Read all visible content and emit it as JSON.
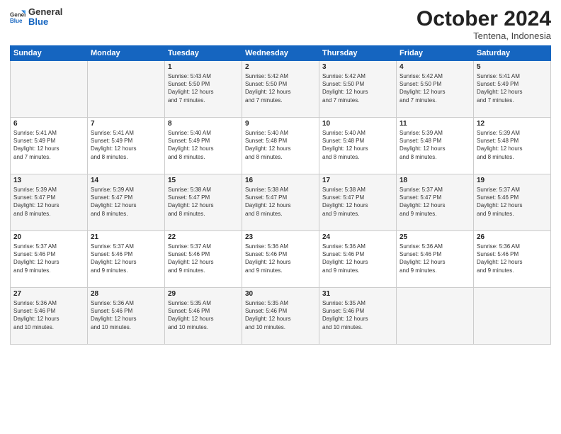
{
  "header": {
    "logo_line1": "General",
    "logo_line2": "Blue",
    "month": "October 2024",
    "location": "Tentena, Indonesia"
  },
  "days_of_week": [
    "Sunday",
    "Monday",
    "Tuesday",
    "Wednesday",
    "Thursday",
    "Friday",
    "Saturday"
  ],
  "weeks": [
    [
      {
        "day": "",
        "info": ""
      },
      {
        "day": "",
        "info": ""
      },
      {
        "day": "1",
        "info": "Sunrise: 5:43 AM\nSunset: 5:50 PM\nDaylight: 12 hours\nand 7 minutes."
      },
      {
        "day": "2",
        "info": "Sunrise: 5:42 AM\nSunset: 5:50 PM\nDaylight: 12 hours\nand 7 minutes."
      },
      {
        "day": "3",
        "info": "Sunrise: 5:42 AM\nSunset: 5:50 PM\nDaylight: 12 hours\nand 7 minutes."
      },
      {
        "day": "4",
        "info": "Sunrise: 5:42 AM\nSunset: 5:50 PM\nDaylight: 12 hours\nand 7 minutes."
      },
      {
        "day": "5",
        "info": "Sunrise: 5:41 AM\nSunset: 5:49 PM\nDaylight: 12 hours\nand 7 minutes."
      }
    ],
    [
      {
        "day": "6",
        "info": "Sunrise: 5:41 AM\nSunset: 5:49 PM\nDaylight: 12 hours\nand 7 minutes."
      },
      {
        "day": "7",
        "info": "Sunrise: 5:41 AM\nSunset: 5:49 PM\nDaylight: 12 hours\nand 8 minutes."
      },
      {
        "day": "8",
        "info": "Sunrise: 5:40 AM\nSunset: 5:49 PM\nDaylight: 12 hours\nand 8 minutes."
      },
      {
        "day": "9",
        "info": "Sunrise: 5:40 AM\nSunset: 5:48 PM\nDaylight: 12 hours\nand 8 minutes."
      },
      {
        "day": "10",
        "info": "Sunrise: 5:40 AM\nSunset: 5:48 PM\nDaylight: 12 hours\nand 8 minutes."
      },
      {
        "day": "11",
        "info": "Sunrise: 5:39 AM\nSunset: 5:48 PM\nDaylight: 12 hours\nand 8 minutes."
      },
      {
        "day": "12",
        "info": "Sunrise: 5:39 AM\nSunset: 5:48 PM\nDaylight: 12 hours\nand 8 minutes."
      }
    ],
    [
      {
        "day": "13",
        "info": "Sunrise: 5:39 AM\nSunset: 5:47 PM\nDaylight: 12 hours\nand 8 minutes."
      },
      {
        "day": "14",
        "info": "Sunrise: 5:39 AM\nSunset: 5:47 PM\nDaylight: 12 hours\nand 8 minutes."
      },
      {
        "day": "15",
        "info": "Sunrise: 5:38 AM\nSunset: 5:47 PM\nDaylight: 12 hours\nand 8 minutes."
      },
      {
        "day": "16",
        "info": "Sunrise: 5:38 AM\nSunset: 5:47 PM\nDaylight: 12 hours\nand 8 minutes."
      },
      {
        "day": "17",
        "info": "Sunrise: 5:38 AM\nSunset: 5:47 PM\nDaylight: 12 hours\nand 9 minutes."
      },
      {
        "day": "18",
        "info": "Sunrise: 5:37 AM\nSunset: 5:47 PM\nDaylight: 12 hours\nand 9 minutes."
      },
      {
        "day": "19",
        "info": "Sunrise: 5:37 AM\nSunset: 5:46 PM\nDaylight: 12 hours\nand 9 minutes."
      }
    ],
    [
      {
        "day": "20",
        "info": "Sunrise: 5:37 AM\nSunset: 5:46 PM\nDaylight: 12 hours\nand 9 minutes."
      },
      {
        "day": "21",
        "info": "Sunrise: 5:37 AM\nSunset: 5:46 PM\nDaylight: 12 hours\nand 9 minutes."
      },
      {
        "day": "22",
        "info": "Sunrise: 5:37 AM\nSunset: 5:46 PM\nDaylight: 12 hours\nand 9 minutes."
      },
      {
        "day": "23",
        "info": "Sunrise: 5:36 AM\nSunset: 5:46 PM\nDaylight: 12 hours\nand 9 minutes."
      },
      {
        "day": "24",
        "info": "Sunrise: 5:36 AM\nSunset: 5:46 PM\nDaylight: 12 hours\nand 9 minutes."
      },
      {
        "day": "25",
        "info": "Sunrise: 5:36 AM\nSunset: 5:46 PM\nDaylight: 12 hours\nand 9 minutes."
      },
      {
        "day": "26",
        "info": "Sunrise: 5:36 AM\nSunset: 5:46 PM\nDaylight: 12 hours\nand 9 minutes."
      }
    ],
    [
      {
        "day": "27",
        "info": "Sunrise: 5:36 AM\nSunset: 5:46 PM\nDaylight: 12 hours\nand 10 minutes."
      },
      {
        "day": "28",
        "info": "Sunrise: 5:36 AM\nSunset: 5:46 PM\nDaylight: 12 hours\nand 10 minutes."
      },
      {
        "day": "29",
        "info": "Sunrise: 5:35 AM\nSunset: 5:46 PM\nDaylight: 12 hours\nand 10 minutes."
      },
      {
        "day": "30",
        "info": "Sunrise: 5:35 AM\nSunset: 5:46 PM\nDaylight: 12 hours\nand 10 minutes."
      },
      {
        "day": "31",
        "info": "Sunrise: 5:35 AM\nSunset: 5:46 PM\nDaylight: 12 hours\nand 10 minutes."
      },
      {
        "day": "",
        "info": ""
      },
      {
        "day": "",
        "info": ""
      }
    ]
  ]
}
